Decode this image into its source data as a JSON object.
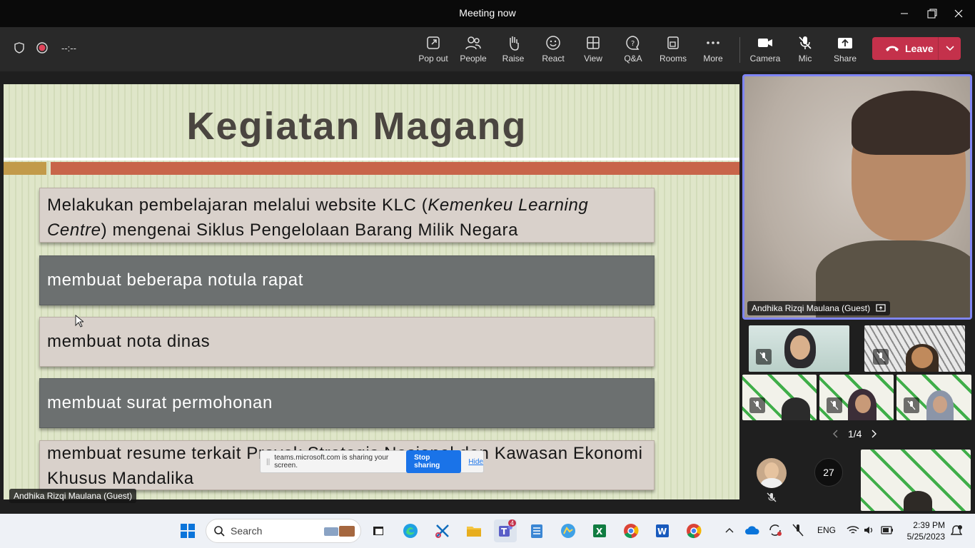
{
  "window": {
    "title": "Meeting now"
  },
  "toolbar": {
    "timer": "--:--",
    "buttons": {
      "popout": "Pop out",
      "people": "People",
      "raise": "Raise",
      "react": "React",
      "view": "View",
      "qa": "Q&A",
      "rooms": "Rooms",
      "more": "More",
      "camera": "Camera",
      "mic": "Mic",
      "share": "Share"
    },
    "leave_label": "Leave"
  },
  "slide": {
    "title": "Kegiatan Magang",
    "item1_a": "Melakukan pembelajaran melalui website KLC (",
    "item1_em": "Kemenkeu Learning Centre",
    "item1_b": ") mengenai Siklus Pengelolaan Barang Milik Negara",
    "item2": "membuat beberapa notula rapat",
    "item3": "membuat nota dinas",
    "item4": "membuat surat permohonan",
    "item5": "membuat resume terkait Proyek Strategis Nasional dan Kawasan Ekonomi Khusus Mandalika"
  },
  "share_bar": {
    "message": "teams.microsoft.com is sharing your screen.",
    "stop_label": "Stop sharing",
    "hide_label": "Hide"
  },
  "presenter_caption": "Andhika Rizqi Maulana (Guest)",
  "main_video": {
    "name": "Andhika Rizqi Maulana (Guest)"
  },
  "pager": {
    "text": "1/4"
  },
  "overflow_count": "27",
  "taskbar": {
    "search_placeholder": "Search",
    "teams_badge": "4",
    "language": "ENG",
    "time": "2:39 PM",
    "date": "5/25/2023"
  }
}
